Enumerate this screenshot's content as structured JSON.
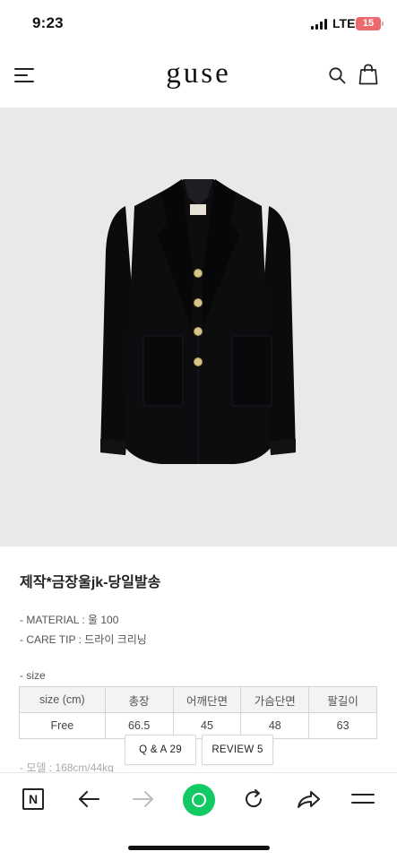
{
  "status_bar": {
    "time": "9:23",
    "network": "LTE",
    "battery": "15"
  },
  "header": {
    "logo": "guse",
    "menu_icon": "hamburger-menu-icon",
    "search_icon": "search-icon",
    "bag_icon": "shopping-bag-icon"
  },
  "product": {
    "image_alt": "black tweed jacket with gold buttons",
    "title": "제작*금장울jk-당일발송",
    "material": "- MATERIAL : 울 100",
    "care_tip": "- CARE TIP : 드라이 크리닝",
    "size_label": "- size",
    "size_table": {
      "headers": [
        "size (cm)",
        "총장",
        "어깨단면",
        "가슴단면",
        "팔길이"
      ],
      "rows": [
        [
          "Free",
          "66.5",
          "45",
          "48",
          "63"
        ]
      ]
    },
    "model_line": "- 모델 : 168cm/44kg"
  },
  "floating_buttons": {
    "qa": "Q & A 29",
    "review": "REVIEW 5"
  },
  "toolbar": {
    "n_label": "N",
    "colors": {
      "green": "#12c964"
    }
  }
}
